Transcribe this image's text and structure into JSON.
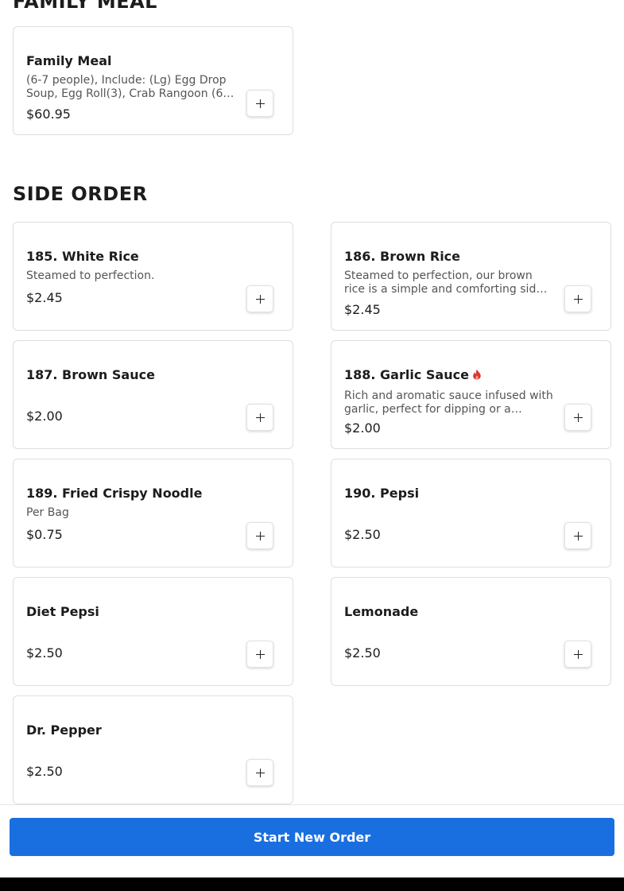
{
  "sections": [
    {
      "title": "FAMILY MEAL",
      "items": [
        {
          "name": "Family Meal",
          "desc": "(6-7 people), Include: (Lg) Egg Drop Soup, Egg Roll(3), Crab Rangoon (6…",
          "price": "$60.95"
        }
      ]
    },
    {
      "title": "SIDE ORDER",
      "items": [
        {
          "name": "185. White Rice",
          "desc": "Steamed to perfection.",
          "price": "$2.45"
        },
        {
          "name": "186. Brown Rice",
          "desc": "Steamed to perfection, our brown rice is a simple and comforting sid…",
          "price": "$2.45"
        },
        {
          "name": "187. Brown Sauce",
          "desc": "",
          "price": "$2.00"
        },
        {
          "name": "188. Garlic Sauce",
          "desc": "Rich and aromatic sauce infused with garlic, perfect for dipping or a…",
          "price": "$2.00",
          "icon": "fire-icon",
          "icon_color": "#d7382e"
        },
        {
          "name": "189. Fried Crispy Noodle",
          "desc": "Per Bag",
          "price": "$0.75"
        },
        {
          "name": "190. Pepsi",
          "desc": "",
          "price": "$2.50"
        },
        {
          "name": "Diet Pepsi",
          "desc": "",
          "price": "$2.50"
        },
        {
          "name": "Lemonade",
          "desc": "",
          "price": "$2.50"
        },
        {
          "name": "Dr. Pepper",
          "desc": "",
          "price": "$2.50"
        }
      ]
    }
  ],
  "add_button_icon": "plus-icon",
  "footer": {
    "start_label": "Start New Order",
    "accent": "#1a6fe0"
  }
}
